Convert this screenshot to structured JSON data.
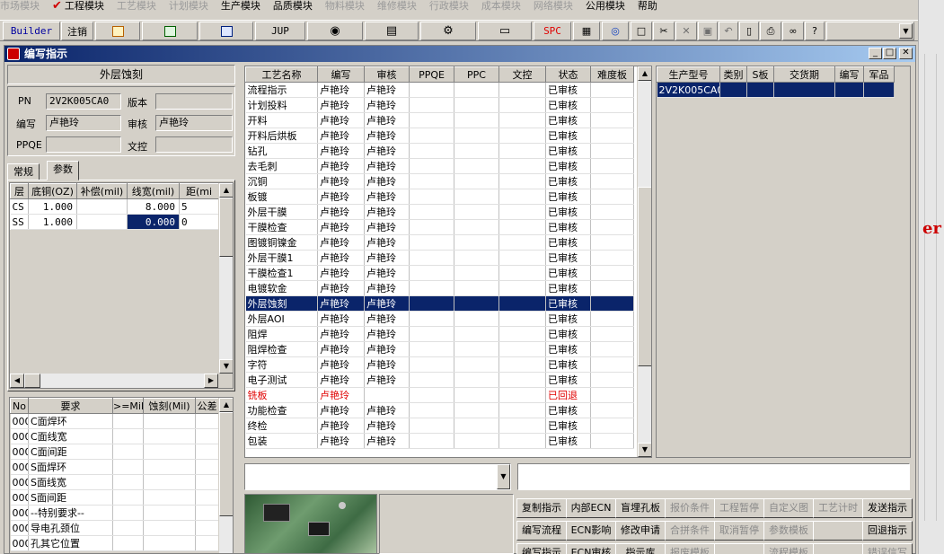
{
  "menu": {
    "items": [
      "市场模块",
      "工程模块",
      "工艺模块",
      "计划模块",
      "生产模块",
      "品质模块",
      "物料模块",
      "维修模块",
      "行政模块",
      "成本模块",
      "网络模块",
      "公用模块",
      "帮助"
    ],
    "active": [
      "工程模块",
      "生产模块",
      "品质模块",
      "公用模块",
      "帮助"
    ]
  },
  "toolbar": {
    "builder": "Builder",
    "logout": "注销",
    "jup": "JUP",
    "spc": "SPC"
  },
  "window": {
    "title": "编写指示"
  },
  "left": {
    "process_name": "外层蚀刻",
    "pn_label": "PN",
    "pn_value": "2V2K005CA0",
    "version_label": "版本",
    "version_value": "",
    "author_label": "编写",
    "author_value": "卢艳玲",
    "reviewer_label": "审核",
    "reviewer_value": "卢艳玲",
    "ppqe_label": "PPQE",
    "ppqe_value": "",
    "controller_label": "文控",
    "controller_value": "",
    "tabs": [
      "常规",
      "参数"
    ],
    "param_headers": [
      "层",
      "底铜(OZ)",
      "补偿(mil)",
      "线宽(mil)",
      "距(mi"
    ],
    "param_rows": [
      [
        "CS",
        "1.000",
        "",
        "8.000",
        "5"
      ],
      [
        "SS",
        "1.000",
        "",
        "0.000",
        "0"
      ]
    ],
    "req_headers": [
      "No",
      "要求",
      ">=Mil",
      "蚀刻(Mil)",
      "公差"
    ],
    "req_rows": [
      [
        "000",
        "C面焊环"
      ],
      [
        "000",
        "C面线宽"
      ],
      [
        "000",
        "C面间距"
      ],
      [
        "000",
        "S面焊环"
      ],
      [
        "000",
        "S面线宽"
      ],
      [
        "000",
        "S面间距"
      ],
      [
        "000",
        "--特别要求--"
      ],
      [
        "000",
        "导电孔颈位"
      ],
      [
        "000",
        "孔其它位置"
      ]
    ]
  },
  "process_grid": {
    "headers": [
      "工艺名称",
      "编写",
      "审核",
      "PPQE",
      "PPC",
      "文控",
      "状态",
      "难度板"
    ],
    "rows": [
      [
        "流程指示",
        "卢艳玲",
        "卢艳玲",
        "",
        "",
        "",
        "已审核"
      ],
      [
        "计划投料",
        "卢艳玲",
        "卢艳玲",
        "",
        "",
        "",
        "已审核"
      ],
      [
        "开料",
        "卢艳玲",
        "卢艳玲",
        "",
        "",
        "",
        "已审核"
      ],
      [
        "开料后烘板",
        "卢艳玲",
        "卢艳玲",
        "",
        "",
        "",
        "已审核"
      ],
      [
        "钻孔",
        "卢艳玲",
        "卢艳玲",
        "",
        "",
        "",
        "已审核"
      ],
      [
        "去毛刺",
        "卢艳玲",
        "卢艳玲",
        "",
        "",
        "",
        "已审核"
      ],
      [
        "沉铜",
        "卢艳玲",
        "卢艳玲",
        "",
        "",
        "",
        "已审核"
      ],
      [
        "板镀",
        "卢艳玲",
        "卢艳玲",
        "",
        "",
        "",
        "已审核"
      ],
      [
        "外层干膜",
        "卢艳玲",
        "卢艳玲",
        "",
        "",
        "",
        "已审核"
      ],
      [
        "干膜检查",
        "卢艳玲",
        "卢艳玲",
        "",
        "",
        "",
        "已审核"
      ],
      [
        "图镀铜镍金",
        "卢艳玲",
        "卢艳玲",
        "",
        "",
        "",
        "已审核"
      ],
      [
        "外层干膜1",
        "卢艳玲",
        "卢艳玲",
        "",
        "",
        "",
        "已审核"
      ],
      [
        "干膜检查1",
        "卢艳玲",
        "卢艳玲",
        "",
        "",
        "",
        "已审核"
      ],
      [
        "电镀软金",
        "卢艳玲",
        "卢艳玲",
        "",
        "",
        "",
        "已审核"
      ],
      [
        "外层蚀刻",
        "卢艳玲",
        "卢艳玲",
        "",
        "",
        "",
        "已审核"
      ],
      [
        "外层AOI",
        "卢艳玲",
        "卢艳玲",
        "",
        "",
        "",
        "已审核"
      ],
      [
        "阻焊",
        "卢艳玲",
        "卢艳玲",
        "",
        "",
        "",
        "已审核"
      ],
      [
        "阻焊检查",
        "卢艳玲",
        "卢艳玲",
        "",
        "",
        "",
        "已审核"
      ],
      [
        "字符",
        "卢艳玲",
        "卢艳玲",
        "",
        "",
        "",
        "已审核"
      ],
      [
        "电子测试",
        "卢艳玲",
        "卢艳玲",
        "",
        "",
        "",
        "已审核"
      ],
      [
        "铣板",
        "卢艳玲",
        "",
        "",
        "",
        "",
        "已回退"
      ],
      [
        "功能检查",
        "卢艳玲",
        "卢艳玲",
        "",
        "",
        "",
        "已审核"
      ],
      [
        "终检",
        "卢艳玲",
        "卢艳玲",
        "",
        "",
        "",
        "已审核"
      ],
      [
        "包装",
        "卢艳玲",
        "卢艳玲",
        "",
        "",
        "",
        "已审核"
      ]
    ],
    "selected_index": 14,
    "returned_index": 20
  },
  "model_grid": {
    "headers": [
      "生产型号",
      "类别",
      "S板",
      "交货期",
      "编写",
      "军品"
    ],
    "rows": [
      [
        "2V2K005CA0",
        "",
        "",
        "",
        "",
        ""
      ]
    ]
  },
  "buttons": [
    [
      "复制指示",
      "内部ECN",
      "盲埋孔板",
      "报价条件",
      "工程暂停",
      "自定义图",
      "工艺计时",
      "发送指示"
    ],
    [
      "编写流程",
      "ECN影响",
      "修改申请",
      "合拼条件",
      "取消暂停",
      "参数模板",
      "",
      "回退指示"
    ],
    [
      "编写指示",
      "ECN审核",
      "指示库",
      "报废模板",
      "",
      "流程模板",
      "",
      "错误信写"
    ]
  ],
  "disabled_buttons": [
    "报价条件",
    "工程暂停",
    "自定义图",
    "工艺计时",
    "合拼条件",
    "取消暂停",
    "参数模板",
    "报废模板",
    "流程模板",
    "错误信写"
  ],
  "side_text": "er"
}
